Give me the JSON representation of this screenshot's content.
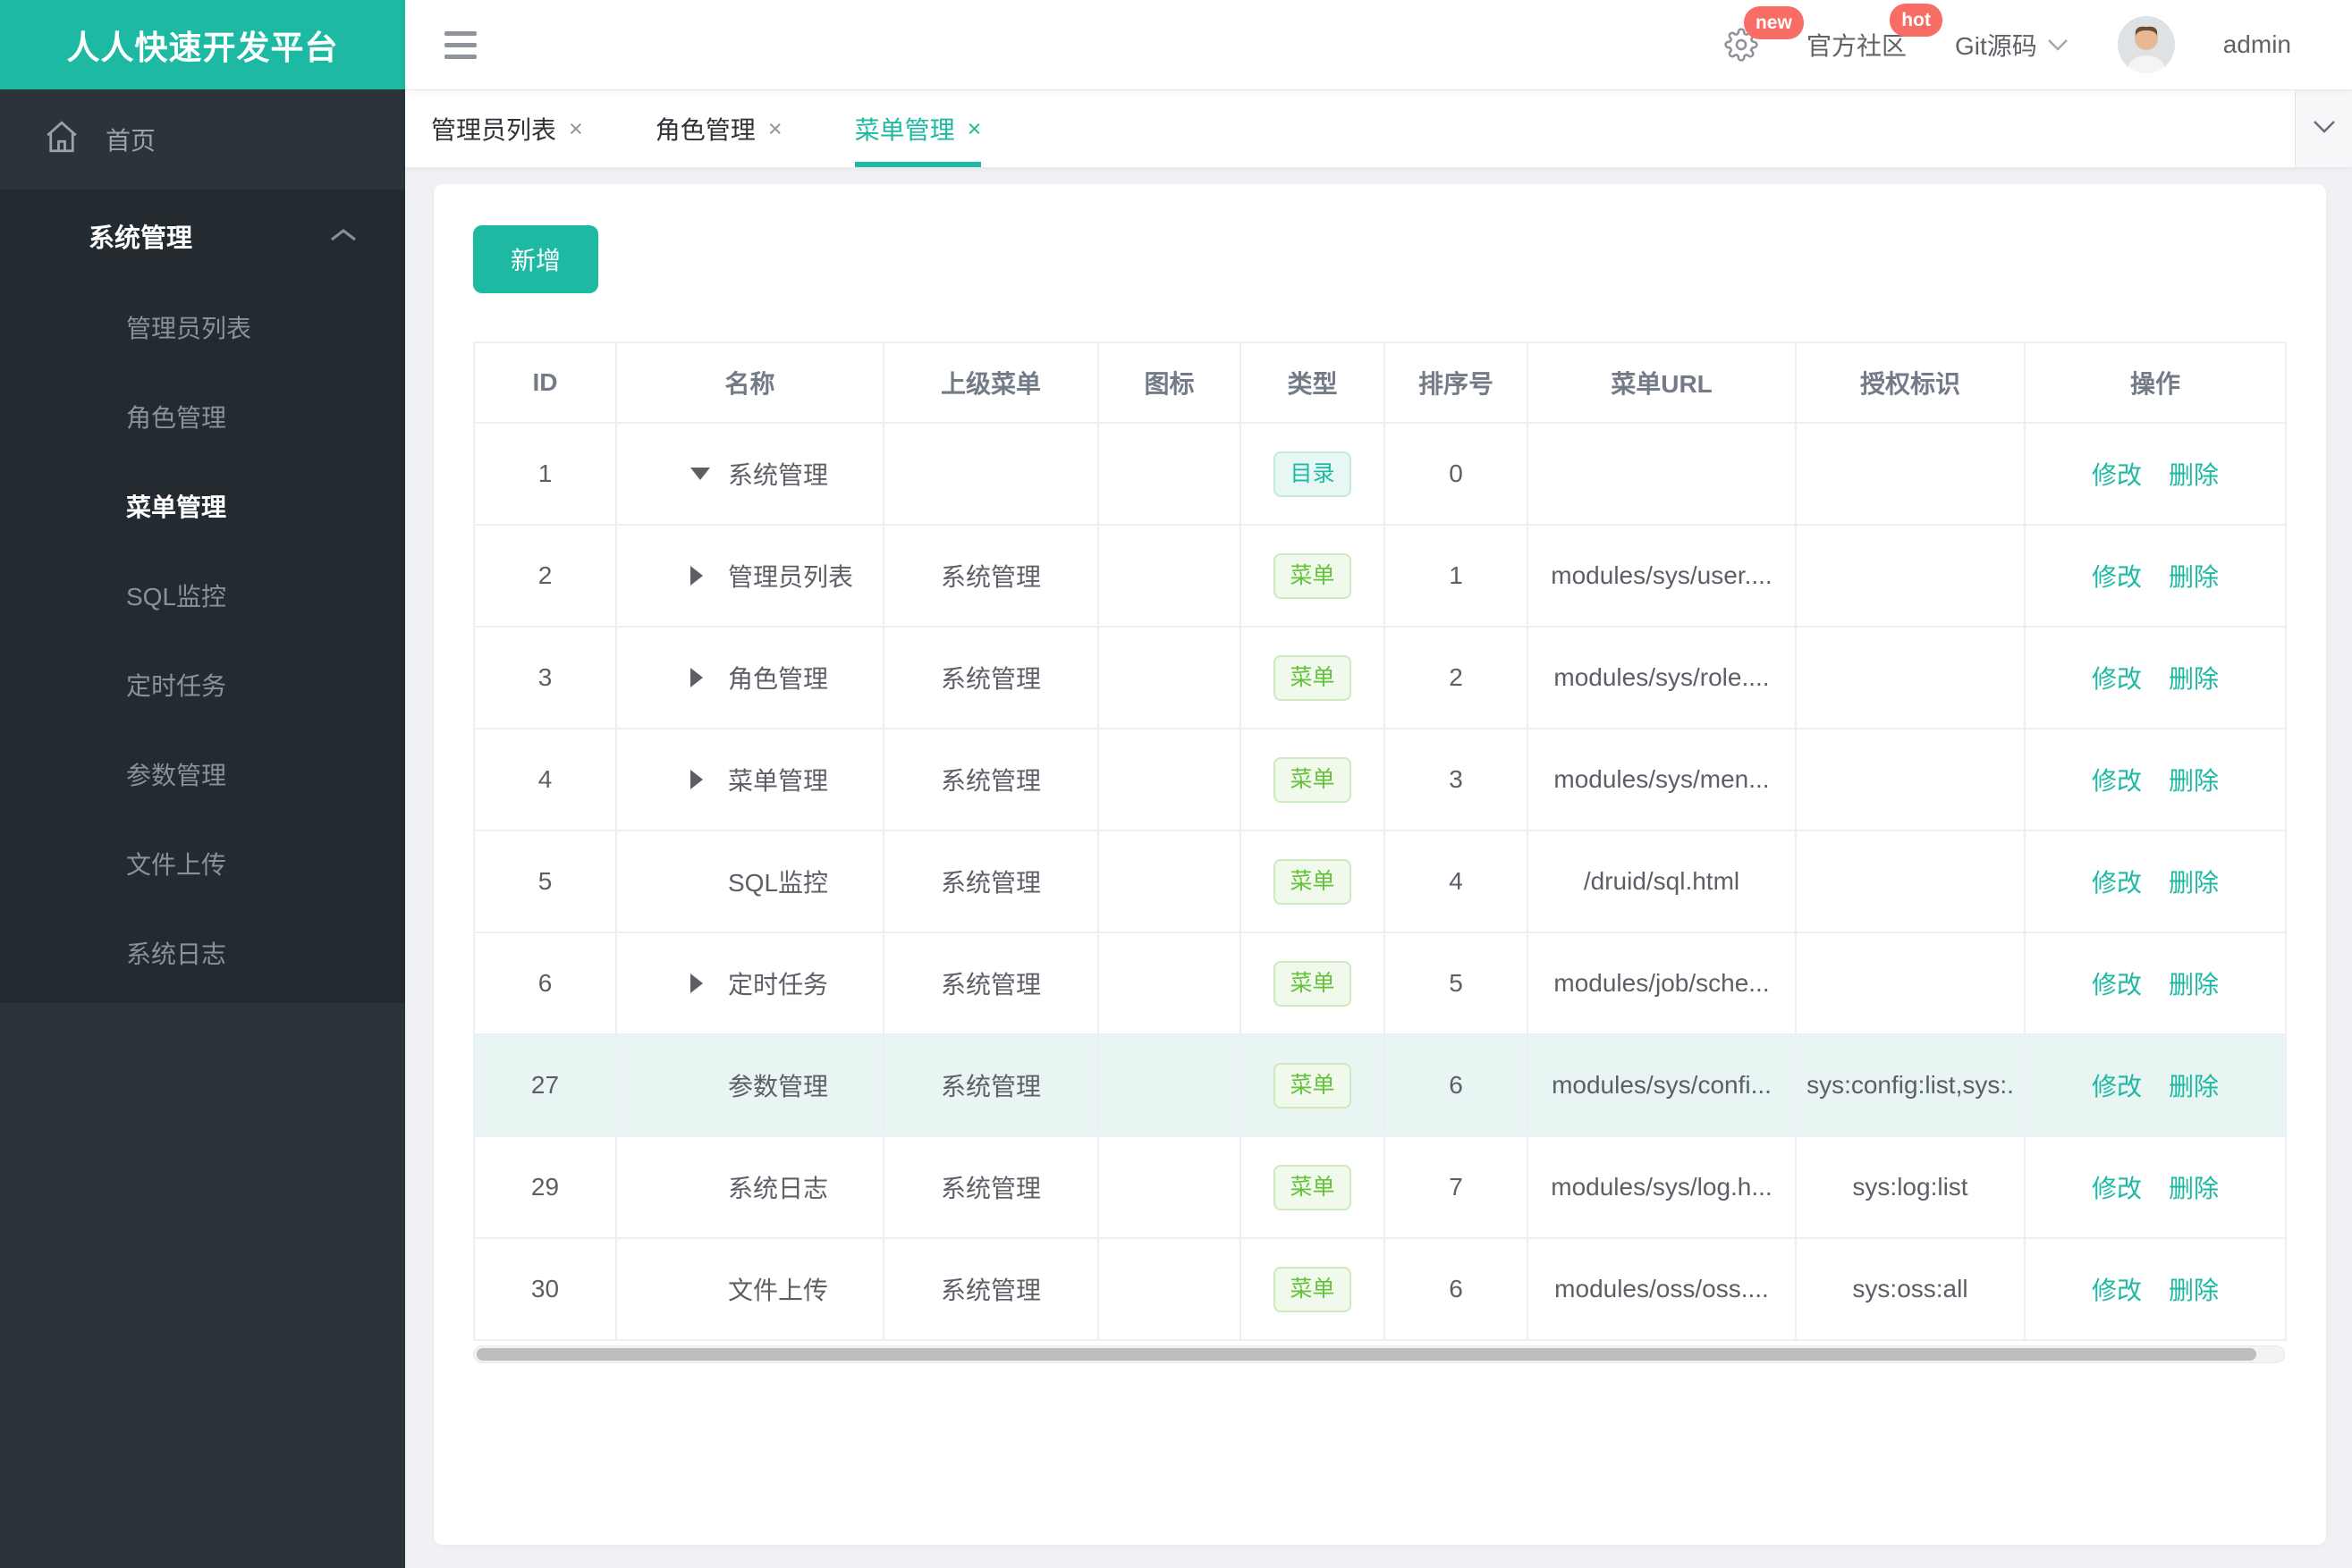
{
  "app": {
    "title": "人人快速开发平台"
  },
  "topbar": {
    "gear_icon": "gear-icon",
    "badge_new": "new",
    "community_label": "官方社区",
    "badge_hot": "hot",
    "git_label": "Git源码",
    "username": "admin"
  },
  "sidebar": {
    "home_label": "首页",
    "group": {
      "label": "系统管理",
      "expanded": true,
      "children": [
        {
          "label": "管理员列表",
          "active": false
        },
        {
          "label": "角色管理",
          "active": false
        },
        {
          "label": "菜单管理",
          "active": true
        },
        {
          "label": "SQL监控",
          "active": false
        },
        {
          "label": "定时任务",
          "active": false
        },
        {
          "label": "参数管理",
          "active": false
        },
        {
          "label": "文件上传",
          "active": false
        },
        {
          "label": "系统日志",
          "active": false
        }
      ]
    }
  },
  "tabs": {
    "items": [
      {
        "label": "管理员列表",
        "active": false
      },
      {
        "label": "角色管理",
        "active": false
      },
      {
        "label": "菜单管理",
        "active": true
      }
    ]
  },
  "page": {
    "add_button": "新增"
  },
  "table": {
    "columns": [
      "ID",
      "名称",
      "上级菜单",
      "图标",
      "类型",
      "排序号",
      "菜单URL",
      "授权标识",
      "操作"
    ],
    "type_badges": {
      "dir": "目录",
      "menu": "菜单"
    },
    "ops": {
      "edit": "修改",
      "delete": "删除"
    },
    "rows": [
      {
        "id": "1",
        "arrow": "down",
        "name": "系统管理",
        "parent": "",
        "icon": "",
        "type": "dir",
        "order": "0",
        "url": "",
        "perm": "",
        "highlighted": false
      },
      {
        "id": "2",
        "arrow": "right",
        "name": "管理员列表",
        "parent": "系统管理",
        "icon": "",
        "type": "menu",
        "order": "1",
        "url": "modules/sys/user....",
        "perm": "",
        "highlighted": false
      },
      {
        "id": "3",
        "arrow": "right",
        "name": "角色管理",
        "parent": "系统管理",
        "icon": "",
        "type": "menu",
        "order": "2",
        "url": "modules/sys/role....",
        "perm": "",
        "highlighted": false
      },
      {
        "id": "4",
        "arrow": "right",
        "name": "菜单管理",
        "parent": "系统管理",
        "icon": "",
        "type": "menu",
        "order": "3",
        "url": "modules/sys/men...",
        "perm": "",
        "highlighted": false
      },
      {
        "id": "5",
        "arrow": "",
        "name": "SQL监控",
        "parent": "系统管理",
        "icon": "",
        "type": "menu",
        "order": "4",
        "url": "/druid/sql.html",
        "perm": "",
        "highlighted": false
      },
      {
        "id": "6",
        "arrow": "right",
        "name": "定时任务",
        "parent": "系统管理",
        "icon": "",
        "type": "menu",
        "order": "5",
        "url": "modules/job/sche...",
        "perm": "",
        "highlighted": false
      },
      {
        "id": "27",
        "arrow": "",
        "name": "参数管理",
        "parent": "系统管理",
        "icon": "",
        "type": "menu",
        "order": "6",
        "url": "modules/sys/confi...",
        "perm": "sys:config:list,sys:.",
        "highlighted": true
      },
      {
        "id": "29",
        "arrow": "",
        "name": "系统日志",
        "parent": "系统管理",
        "icon": "",
        "type": "menu",
        "order": "7",
        "url": "modules/sys/log.h...",
        "perm": "sys:log:list",
        "highlighted": false
      },
      {
        "id": "30",
        "arrow": "",
        "name": "文件上传",
        "parent": "系统管理",
        "icon": "",
        "type": "menu",
        "order": "6",
        "url": "modules/oss/oss....",
        "perm": "sys:oss:all",
        "highlighted": false
      }
    ]
  },
  "colors": {
    "accent": "#1db9a2",
    "badge_red": "#f86d65",
    "type_dir_green": "#1db9a2",
    "type_menu_green": "#64c23a",
    "row_highlight": "#e8f5f2",
    "sidebar_bg": "#2b343b",
    "submenu_bg": "#232b31"
  }
}
